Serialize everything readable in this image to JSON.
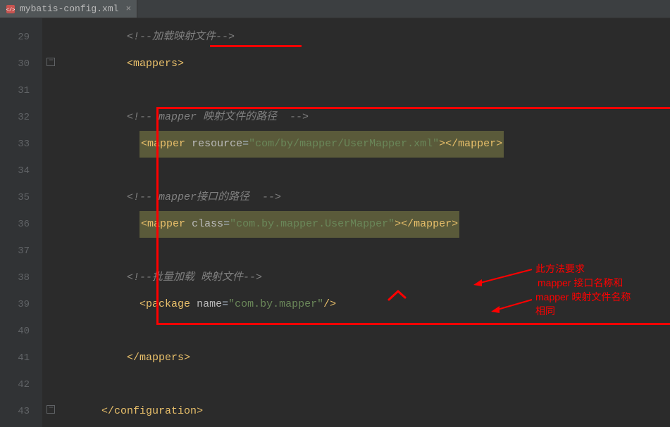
{
  "tab": {
    "filename": "mybatis-config.xml"
  },
  "lineNumbers": [
    "29",
    "30",
    "31",
    "32",
    "33",
    "34",
    "35",
    "36",
    "37",
    "38",
    "39",
    "40",
    "41",
    "42",
    "43"
  ],
  "code": {
    "l29_comment": "<!--加载映射文件-->",
    "l30_open": "<",
    "l30_tag": "mappers",
    "l30_close": ">",
    "l32_comment": "<!-- mapper 映射文件的路径  -->",
    "l33_open": "<",
    "l33_tag": "mapper",
    "l33_attr": "resource",
    "l33_val": "\"com/by/mapper/UserMapper.xml\"",
    "l33_closeopen": "></",
    "l33_closetag": "mapper",
    "l33_end": ">",
    "l35_comment": "<!-- mapper接口的路径  -->",
    "l36_open": "<",
    "l36_tag": "mapper",
    "l36_attr": "class",
    "l36_val": "\"com.by.mapper.UserMapper\"",
    "l36_closeopen": "></",
    "l36_closetag": "mapper",
    "l36_end": ">",
    "l38_comment": "<!--批量加载 映射文件-->",
    "l39_open": "<",
    "l39_tag": "package",
    "l39_attr": "name",
    "l39_val": "\"com.by.mapper\"",
    "l39_end": "/>",
    "l41_open": "</",
    "l41_tag": "mappers",
    "l41_close": ">",
    "l43_open": "</",
    "l43_tag": "configuration",
    "l43_close": ">"
  },
  "annotations": {
    "a1": "此方法要求",
    "a2": "mapper 接口名称和",
    "a3": "mapper 映射文件名称",
    "a4": "相同"
  }
}
